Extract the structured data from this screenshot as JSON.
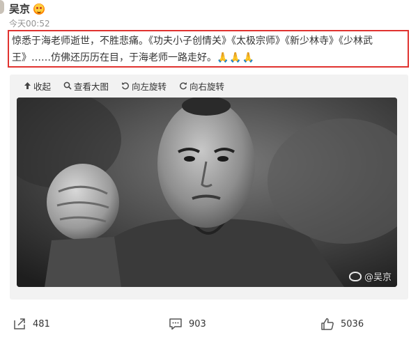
{
  "post": {
    "author": "吴京",
    "time": "今天00:52",
    "text": "惊悉于海老师逝世，不胜悲痛。《功夫小子创情关》《太极宗师》《新少林寺》《少林武王》……仿佛还历历在目，于海老师一路走好。",
    "emoji": "🙏🙏🙏"
  },
  "toolbar": {
    "collapse": "收起",
    "view_large": "查看大图",
    "rotate_left": "向左旋转",
    "rotate_right": "向右旋转"
  },
  "image": {
    "watermark": "@吴京"
  },
  "footer": {
    "repost_count": "481",
    "comment_count": "903",
    "like_count": "5036"
  },
  "colors": {
    "highlight_border": "#e0322f",
    "text": "#333333",
    "muted": "#939393",
    "media_bg": "#f2f2f2"
  }
}
